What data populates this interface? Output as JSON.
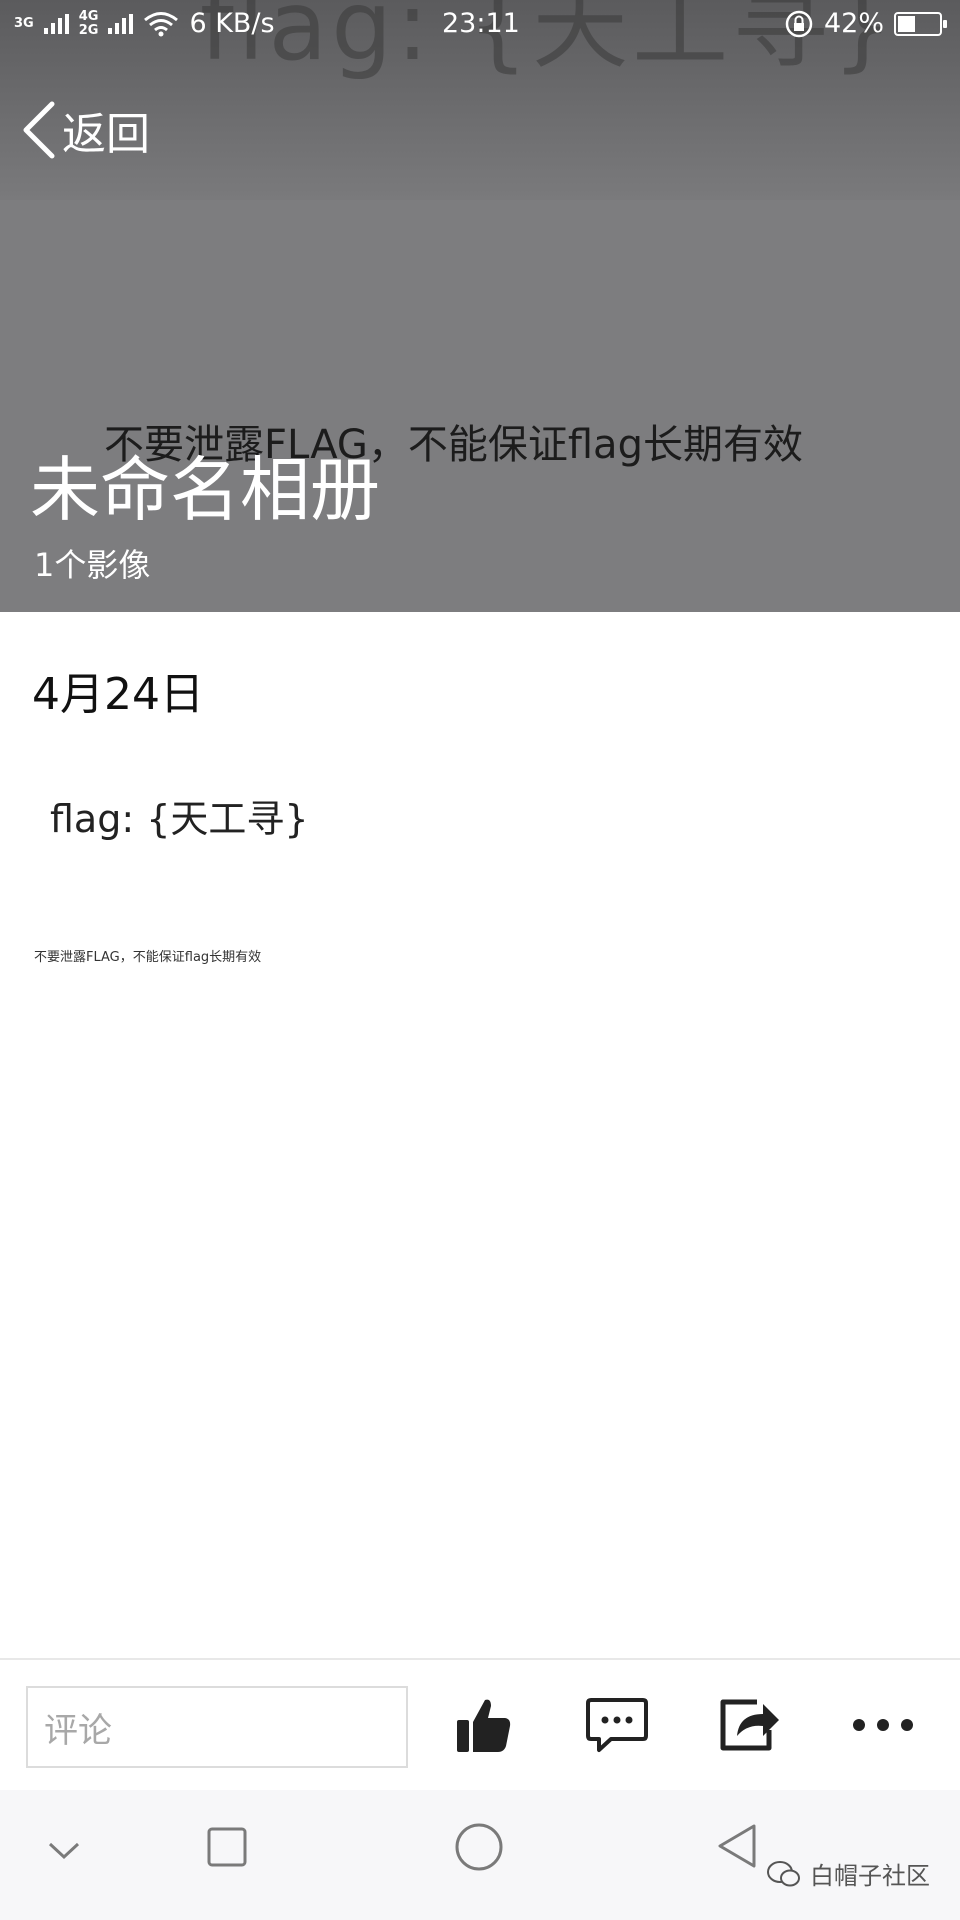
{
  "status_bar": {
    "net1": "3G",
    "net2_top": "4G",
    "net2_bottom": "2G",
    "speed": "6 KB/s",
    "time": "23:11",
    "battery": "42%",
    "battery_level": 0.42
  },
  "header": {
    "back_label": "返回",
    "cover_flag_text": "flag: {天工寻}",
    "cover_warning": "不要泄露FLAG，不能保证flag长期有效",
    "album_title": "未命名相册",
    "item_count": "1个影像"
  },
  "content": {
    "date": "4月24日",
    "photo_flag": "flag: {天工寻}",
    "photo_warning": "不要泄露FLAG，不能保证flag长期有效"
  },
  "action_bar": {
    "comment_placeholder": "评论",
    "icons": [
      "like-icon",
      "comment-icon",
      "share-icon",
      "more-icon"
    ]
  },
  "nav_bar": {
    "icons": [
      "chevron-down-icon",
      "recents-icon",
      "home-icon",
      "back-icon"
    ],
    "watermark": "白帽子社区"
  },
  "colors": {
    "cover_bg": "#7d7d7f",
    "icon_dark": "#222222"
  }
}
